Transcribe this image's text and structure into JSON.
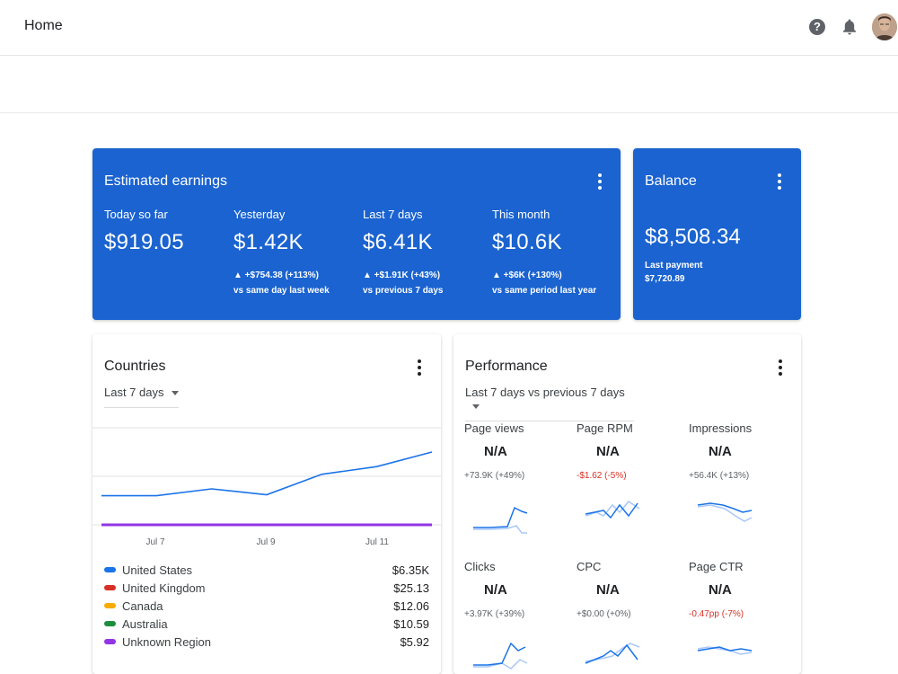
{
  "header": {
    "title": "Home",
    "icons": [
      "help-icon",
      "notifications-icon",
      "avatar"
    ]
  },
  "earnings": {
    "title": "Estimated earnings",
    "stats": [
      {
        "label": "Today so far",
        "value": "$919.05",
        "change": "",
        "compare": ""
      },
      {
        "label": "Yesterday",
        "value": "$1.42K",
        "change": "▲ +$754.38 (+113%)",
        "compare": "vs same day last week"
      },
      {
        "label": "Last 7 days",
        "value": "$6.41K",
        "change": "▲ +$1.91K (+43%)",
        "compare": "vs previous 7 days"
      },
      {
        "label": "This month",
        "value": "$10.6K",
        "change": "▲ +$6K (+130%)",
        "compare": "vs same period last year"
      }
    ]
  },
  "balance": {
    "title": "Balance",
    "value": "$8,508.34",
    "last_payment_label": "Last payment",
    "last_payment_value": "$7,720.89"
  },
  "countries": {
    "title": "Countries",
    "range": "Last 7 days",
    "chart_data": {
      "type": "line",
      "x_ticks": [
        "Jul 7",
        "Jul 9",
        "Jul 11"
      ],
      "series": [
        {
          "name": "United States",
          "color": "#1a73e8",
          "values": [
            0.3,
            0.3,
            0.37,
            0.31,
            0.52,
            0.6,
            0.75
          ]
        },
        {
          "name": "Unknown Region",
          "color": "#9334e6",
          "values": [
            0,
            0,
            0,
            0,
            0,
            0,
            0
          ]
        }
      ]
    },
    "legend": [
      {
        "name": "United States",
        "amount": "$6.35K",
        "color": "#1a73e8"
      },
      {
        "name": "United Kingdom",
        "amount": "$25.13",
        "color": "#d93025"
      },
      {
        "name": "Canada",
        "amount": "$12.06",
        "color": "#f9ab00"
      },
      {
        "name": "Australia",
        "amount": "$10.59",
        "color": "#1e8e3e"
      },
      {
        "name": "Unknown Region",
        "amount": "$5.92",
        "color": "#9334e6"
      }
    ]
  },
  "performance": {
    "title": "Performance",
    "range": "Last 7 days vs previous 7 days",
    "metrics": [
      {
        "label": "Page views",
        "value": "N/A",
        "delta": "+73.9K (+49%)",
        "negative": false
      },
      {
        "label": "Page RPM",
        "value": "N/A",
        "delta": "-$1.62 (-5%)",
        "negative": true
      },
      {
        "label": "Impressions",
        "value": "N/A",
        "delta": "+56.4K (+13%)",
        "negative": false
      },
      {
        "label": "Clicks",
        "value": "N/A",
        "delta": "+3.97K (+39%)",
        "negative": false
      },
      {
        "label": "CPC",
        "value": "N/A",
        "delta": "+$0.00 (+0%)",
        "negative": false
      },
      {
        "label": "Page CTR",
        "value": "N/A",
        "delta": "-0.47pp (-7%)",
        "negative": true
      }
    ]
  }
}
